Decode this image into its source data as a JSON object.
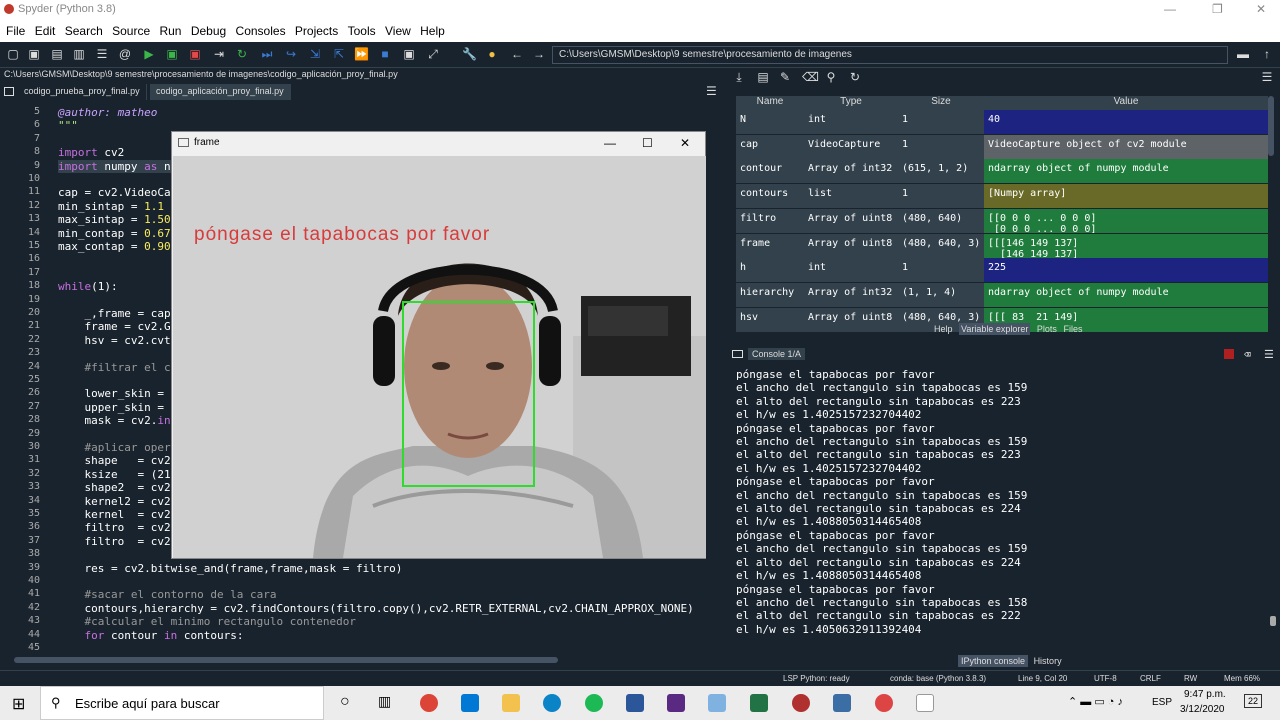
{
  "window": {
    "title": "Spyder (Python 3.8)"
  },
  "menu": [
    "File",
    "Edit",
    "Search",
    "Source",
    "Run",
    "Debug",
    "Consoles",
    "Projects",
    "Tools",
    "View",
    "Help"
  ],
  "toolbar": {
    "path": "C:\\Users\\GMSM\\Desktop\\9 semestre\\procesamiento de imagenes"
  },
  "editor": {
    "filepath": "C:\\Users\\GMSM\\Desktop\\9 semestre\\procesamiento de imagenes\\codigo_aplicación_proy_final.py",
    "tabs": [
      {
        "label": "codigo_prueba_proy_final.py"
      },
      {
        "label": "codigo_aplicación_proy_final.py"
      }
    ],
    "lines": [
      {
        "n": "5",
        "t": "@author: matheo"
      },
      {
        "n": "6",
        "t": "\"\"\""
      },
      {
        "n": "7",
        "t": ""
      },
      {
        "n": "8",
        "t": "import cv2"
      },
      {
        "n": "9",
        "t": "import numpy as n"
      },
      {
        "n": "10",
        "t": ""
      },
      {
        "n": "11",
        "t": "cap = cv2.VideoCa"
      },
      {
        "n": "12",
        "t": "min_sintap = 1.1"
      },
      {
        "n": "13",
        "t": "max_sintap = 1.50"
      },
      {
        "n": "14",
        "t": "min_contap = 0.67"
      },
      {
        "n": "15",
        "t": "max_contap = 0.90"
      },
      {
        "n": "16",
        "t": ""
      },
      {
        "n": "17",
        "t": ""
      },
      {
        "n": "18",
        "t": "while(1):"
      },
      {
        "n": "19",
        "t": ""
      },
      {
        "n": "20",
        "t": "    _,frame = cap"
      },
      {
        "n": "21",
        "t": "    frame = cv2.G"
      },
      {
        "n": "22",
        "t": "    hsv = cv2.cvt"
      },
      {
        "n": "23",
        "t": ""
      },
      {
        "n": "24",
        "t": "    #filtrar el c"
      },
      {
        "n": "25",
        "t": ""
      },
      {
        "n": "26",
        "t": "    lower_skin ="
      },
      {
        "n": "27",
        "t": "    upper_skin ="
      },
      {
        "n": "28",
        "t": "    mask = cv2.in"
      },
      {
        "n": "29",
        "t": ""
      },
      {
        "n": "30",
        "t": "    #aplicar oper"
      },
      {
        "n": "31",
        "t": "    shape   = cv2"
      },
      {
        "n": "32",
        "t": "    ksize   = (21"
      },
      {
        "n": "33",
        "t": "    shape2  = cv2"
      },
      {
        "n": "34",
        "t": "    kernel2 = cv2"
      },
      {
        "n": "35",
        "t": "    kernel  = cv2"
      },
      {
        "n": "36",
        "t": "    filtro  = cv2"
      },
      {
        "n": "37",
        "t": "    filtro  = cv2"
      },
      {
        "n": "38",
        "t": ""
      },
      {
        "n": "39",
        "t": "    res = cv2.bitwise_and(frame,frame,mask = filtro)"
      },
      {
        "n": "40",
        "t": ""
      },
      {
        "n": "41",
        "t": "    #sacar el contorno de la cara"
      },
      {
        "n": "42",
        "t": "    contours,hierarchy = cv2.findContours(filtro.copy(),cv2.RETR_EXTERNAL,cv2.CHAIN_APPROX_NONE)"
      },
      {
        "n": "43",
        "t": "    #calcular el minimo rectangulo contenedor"
      },
      {
        "n": "44",
        "t": "    for contour in contours:"
      },
      {
        "n": "45",
        "t": ""
      }
    ]
  },
  "frame_window": {
    "title": "frame",
    "message": "póngase el tapabocas por favor"
  },
  "variable_explorer": {
    "headers": [
      "Name",
      "Type",
      "Size",
      "Value"
    ],
    "rows": [
      {
        "name": "N",
        "type": "int",
        "size": "1",
        "value": "40",
        "color": "#1c2380"
      },
      {
        "name": "cap",
        "type": "VideoCapture",
        "size": "1",
        "value": "VideoCapture object of cv2 module",
        "color": "#5d6367"
      },
      {
        "name": "contour",
        "type": "Array of int32",
        "size": "(615, 1, 2)",
        "value": "ndarray object of numpy module",
        "color": "#1f7c3c"
      },
      {
        "name": "contours",
        "type": "list",
        "size": "1",
        "value": "[Numpy array]",
        "color": "#6a6a28"
      },
      {
        "name": "filtro",
        "type": "Array of uint8",
        "size": "(480, 640)",
        "value": "[[0 0 0 ... 0 0 0]\n [0 0 0 ... 0 0 0]",
        "color": "#1f7c3c"
      },
      {
        "name": "frame",
        "type": "Array of uint8",
        "size": "(480, 640, 3)",
        "value": "[[[146 149 137]\n  [146 149 137]",
        "color": "#1f7c3c"
      },
      {
        "name": "h",
        "type": "int",
        "size": "1",
        "value": "225",
        "color": "#1c2380"
      },
      {
        "name": "hierarchy",
        "type": "Array of int32",
        "size": "(1, 1, 4)",
        "value": "ndarray object of numpy module",
        "color": "#1f7c3c"
      },
      {
        "name": "hsv",
        "type": "Array of uint8",
        "size": "(480, 640, 3)",
        "value": "[[[ 83  21 149]",
        "color": "#1f7c3c"
      }
    ],
    "pane_tabs": [
      "Help",
      "Variable explorer",
      "Plots",
      "Files"
    ]
  },
  "console": {
    "tab": "Console 1/A",
    "lines": [
      "póngase el tapabocas por favor",
      "el ancho del rectangulo sin tapabocas es 159",
      "el alto del rectangulo sin tapabocas es 223",
      "el h/w es 1.4025157232704402",
      "póngase el tapabocas por favor",
      "el ancho del rectangulo sin tapabocas es 159",
      "el alto del rectangulo sin tapabocas es 223",
      "el h/w es 1.4025157232704402",
      "póngase el tapabocas por favor",
      "el ancho del rectangulo sin tapabocas es 159",
      "el alto del rectangulo sin tapabocas es 224",
      "el h/w es 1.4088050314465408",
      "póngase el tapabocas por favor",
      "el ancho del rectangulo sin tapabocas es 159",
      "el alto del rectangulo sin tapabocas es 224",
      "el h/w es 1.4088050314465408",
      "póngase el tapabocas por favor",
      "el ancho del rectangulo sin tapabocas es 158",
      "el alto del rectangulo sin tapabocas es 222",
      "el h/w es 1.4050632911392404"
    ],
    "bottom_tabs": [
      "IPython console",
      "History"
    ]
  },
  "status": {
    "lsp": "LSP Python: ready",
    "conda": "conda: base (Python 3.8.3)",
    "pos": "Line 9, Col 20",
    "enc": "UTF-8",
    "eol": "CRLF",
    "rw": "RW",
    "mem": "Mem 66%"
  },
  "taskbar": {
    "search": "Escribe aquí para buscar",
    "time": "9:47 p.m.",
    "date": "3/12/2020",
    "lang": "ESP",
    "notif": "22"
  }
}
